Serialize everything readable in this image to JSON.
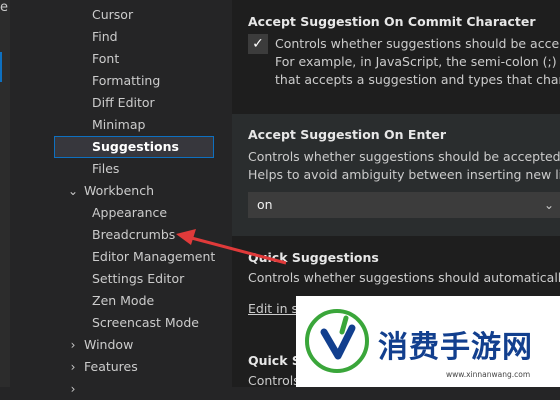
{
  "activity_bar": {
    "top_glyph": "e"
  },
  "tree": {
    "items": [
      {
        "label": "Cursor"
      },
      {
        "label": "Find"
      },
      {
        "label": "Font"
      },
      {
        "label": "Formatting"
      },
      {
        "label": "Diff Editor"
      },
      {
        "label": "Minimap"
      },
      {
        "label": "Suggestions"
      },
      {
        "label": "Files"
      },
      {
        "label": "Workbench"
      },
      {
        "label": "Appearance"
      },
      {
        "label": "Breadcrumbs"
      },
      {
        "label": "Editor Management"
      },
      {
        "label": "Settings Editor"
      },
      {
        "label": "Zen Mode"
      },
      {
        "label": "Screencast Mode"
      },
      {
        "label": "Window"
      },
      {
        "label": "Features"
      }
    ]
  },
  "settings": {
    "commit_char": {
      "title": "Accept Suggestion On Commit Character",
      "desc1": "Controls whether suggestions should be accepted",
      "desc2": "For example, in JavaScript, the semi-colon (;) can",
      "desc3": "that accepts a suggestion and types that characte",
      "checked": true
    },
    "on_enter": {
      "title": "Accept Suggestion On Enter",
      "desc1": "Controls whether suggestions should be accepted on",
      "desc2": "Helps to avoid ambiguity between inserting new lines",
      "value": "on"
    },
    "quick": {
      "title": "Quick Suggestions",
      "desc": "Controls whether suggestions should automatically sh",
      "link": "Edit in settings.json"
    },
    "quick2": {
      "title": "Quick Su",
      "desc": "Controls"
    }
  },
  "watermark": {
    "brand": "消费手游网",
    "url": "www.xinnanwang.com"
  },
  "colors": {
    "accent": "#0e70c0",
    "arrow": "#e03a3a",
    "brand": "#123f8e",
    "logo_green": "#3aa63a"
  }
}
